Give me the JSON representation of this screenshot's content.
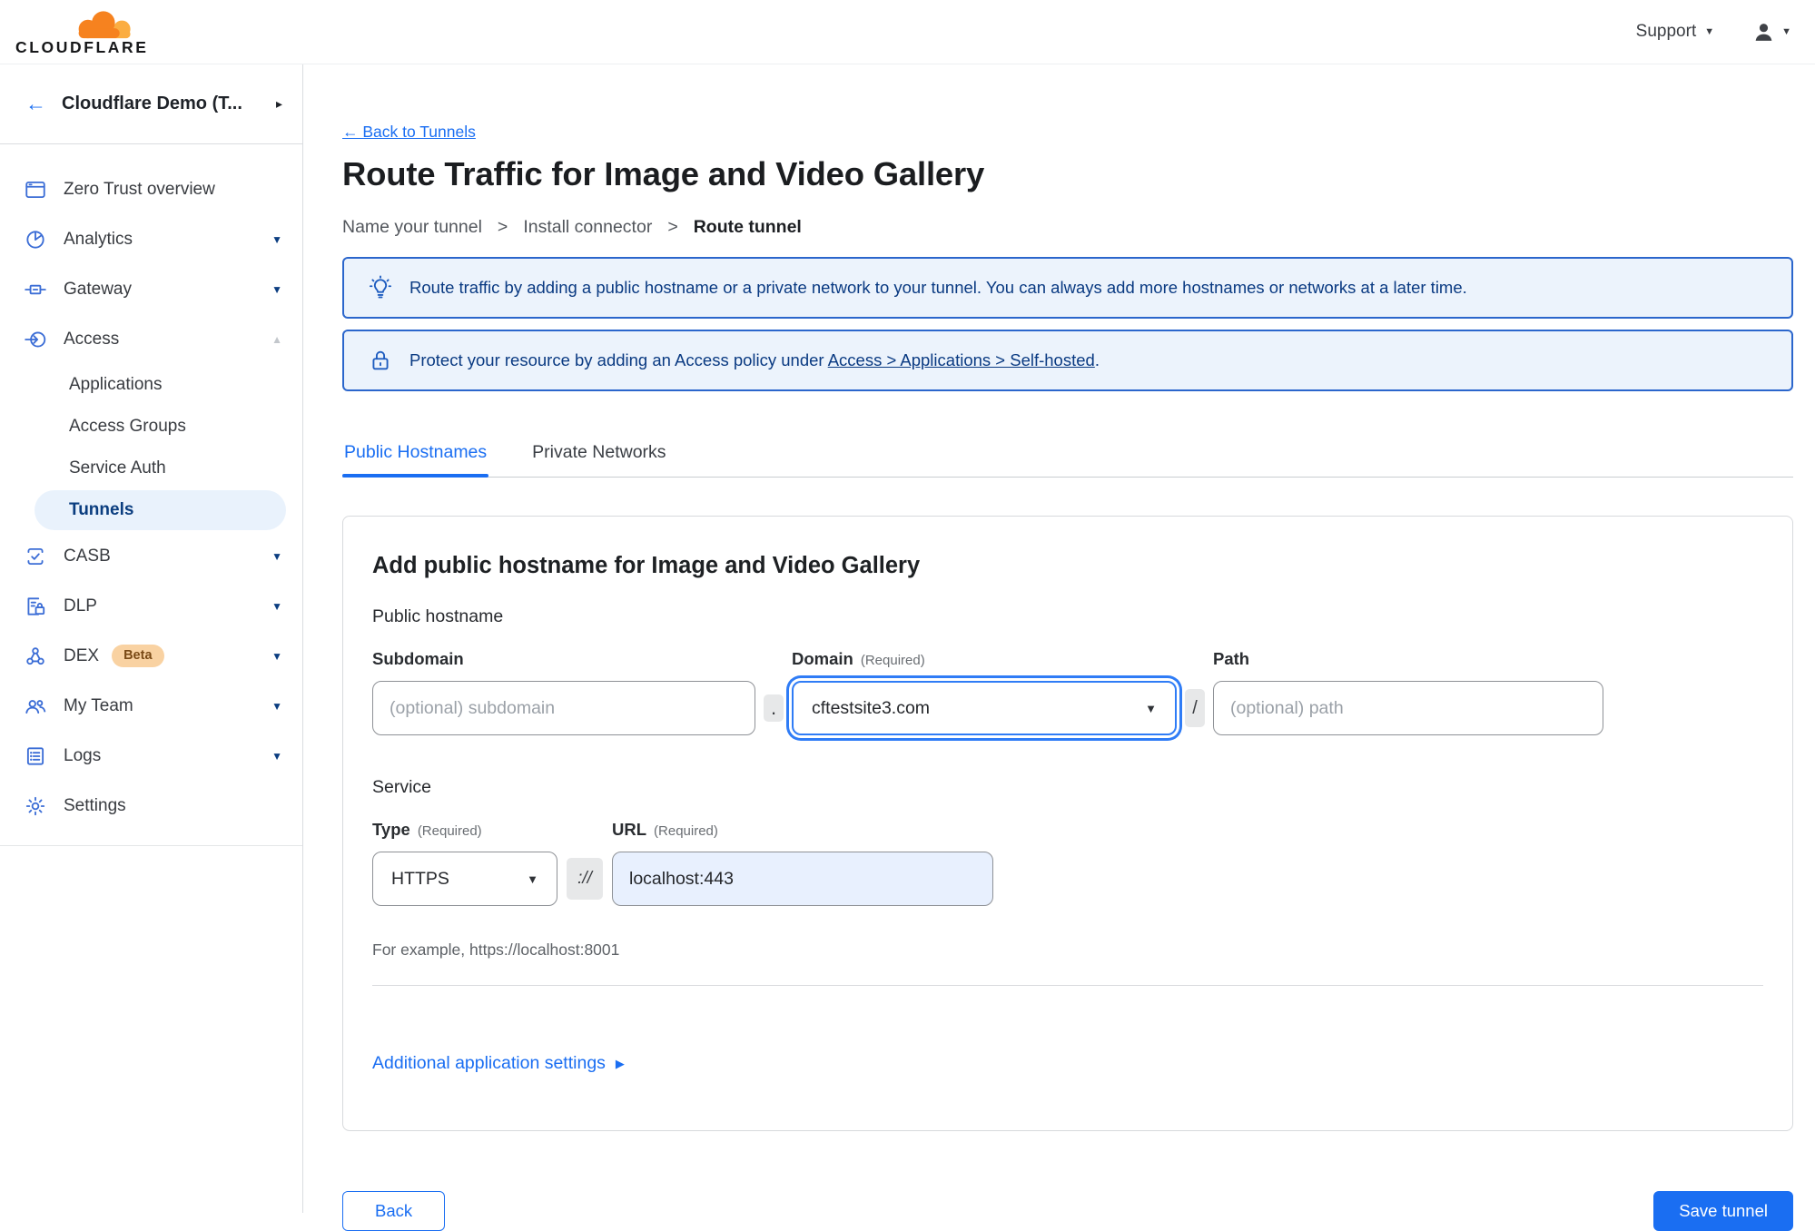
{
  "topbar": {
    "brand": "CLOUDFLARE",
    "support_label": "Support"
  },
  "sidebar": {
    "account_label": "Cloudflare Demo (T...",
    "items": [
      {
        "label": "Zero Trust overview"
      },
      {
        "label": "Analytics"
      },
      {
        "label": "Gateway"
      },
      {
        "label": "Access"
      },
      {
        "label": "Applications"
      },
      {
        "label": "Access Groups"
      },
      {
        "label": "Service Auth"
      },
      {
        "label": "Tunnels"
      },
      {
        "label": "CASB"
      },
      {
        "label": "DLP"
      },
      {
        "label": "DEX",
        "badge": "Beta"
      },
      {
        "label": "My Team"
      },
      {
        "label": "Logs"
      },
      {
        "label": "Settings"
      }
    ]
  },
  "page": {
    "back_link": "← Back to Tunnels",
    "title": "Route Traffic for Image and Video Gallery",
    "steps": {
      "step1": "Name your tunnel",
      "step2": "Install connector",
      "step3": "Route tunnel"
    },
    "banner_tip": "Route traffic by adding a public hostname or a private network to your tunnel. You can always add more hostnames or networks at a later time.",
    "banner_protect_prefix": "Protect your resource by adding an Access policy under ",
    "banner_protect_link": "Access > Applications > Self-hosted",
    "banner_protect_suffix": ".",
    "tabs": {
      "public": "Public Hostnames",
      "private": "Private Networks"
    }
  },
  "form": {
    "card_title": "Add public hostname for Image and Video Gallery",
    "group1": "Public hostname",
    "subdomain_label": "Subdomain",
    "subdomain_placeholder": "(optional) subdomain",
    "dot": ".",
    "domain_label": "Domain",
    "required_hint": "(Required)",
    "domain_value": "cftestsite3.com",
    "slash": "/",
    "path_label": "Path",
    "path_placeholder": "(optional) path",
    "group2": "Service",
    "type_label": "Type",
    "type_value": "HTTPS",
    "scheme": "://",
    "url_label": "URL",
    "url_value": "localhost:443",
    "example": "For example, https://localhost:8001",
    "additional": "Additional application settings",
    "back_button": "Back",
    "save_button": "Save tunnel"
  },
  "glyphs": {
    "chevron_down": "▼",
    "chevron_up": "▲",
    "caret_right": "▸",
    "caret_play": "▶",
    "select_caret": "▼",
    "back_arrow": "←",
    "step_sep": ">"
  },
  "colors": {
    "accent": "#1a6ef2",
    "banner_text": "#0a3a82",
    "banner_bg": "#ecf3fc",
    "banner_border": "#2b66cc",
    "autofill_bg": "#e8f0fe",
    "active_pill_bg": "#e9f2fc",
    "active_pill_text": "#0a3d7f",
    "brand_orange": "#f6821f",
    "brand_orange_light": "#fbad41",
    "beta_badge_bg": "#f9d2a2",
    "beta_badge_text": "#7a4a16"
  }
}
